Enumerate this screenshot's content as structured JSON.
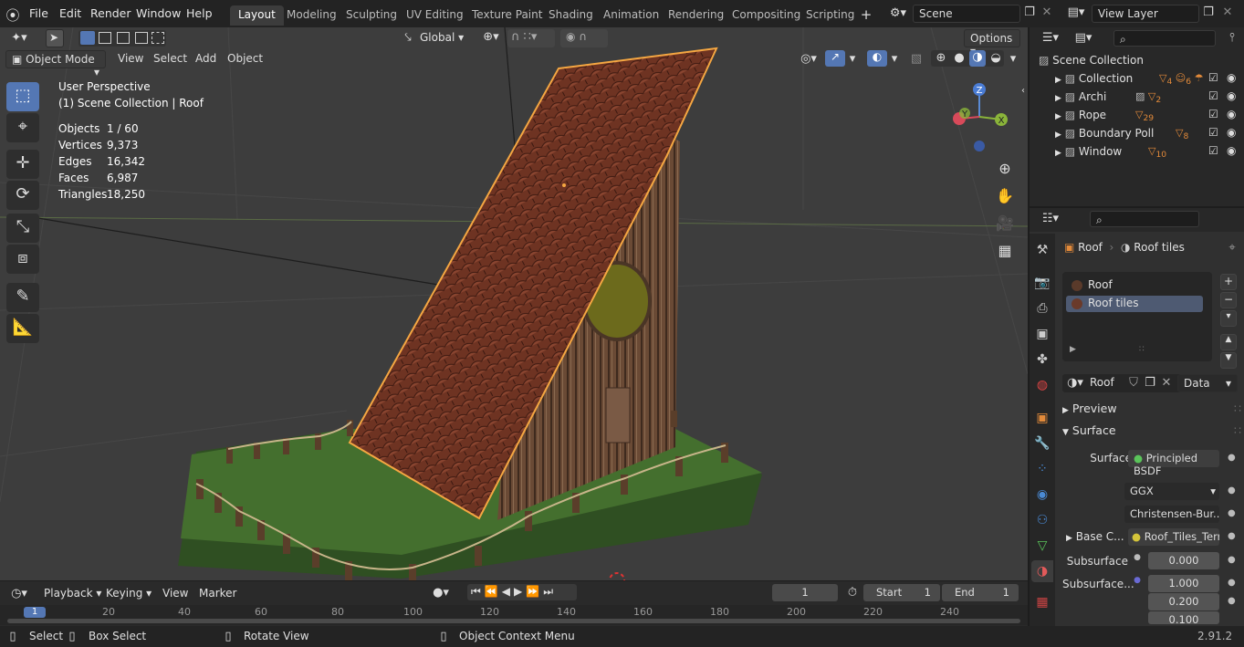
{
  "menubar": {
    "items": [
      "File",
      "Edit",
      "Render",
      "Window",
      "Help"
    ]
  },
  "workspaces": [
    "Layout",
    "Modeling",
    "Sculpting",
    "UV Editing",
    "Texture Paint",
    "Shading",
    "Animation",
    "Rendering",
    "Compositing",
    "Scripting"
  ],
  "active_workspace": "Layout",
  "scene": {
    "name": "Scene"
  },
  "view_layer": {
    "name": "View Layer"
  },
  "viewport_header": {
    "transform_orientation": "Global",
    "options_label": "Options",
    "mode": "Object Mode",
    "menus": [
      "View",
      "Select",
      "Add",
      "Object"
    ]
  },
  "overlay_info": {
    "perspective": "User Perspective",
    "context": "(1) Scene Collection | Roof",
    "stats": [
      {
        "label": "Objects",
        "value": "1 / 60"
      },
      {
        "label": "Vertices",
        "value": "9,373"
      },
      {
        "label": "Edges",
        "value": "16,342"
      },
      {
        "label": "Faces",
        "value": "6,987"
      },
      {
        "label": "Triangles",
        "value": "18,250"
      }
    ]
  },
  "gizmo": {
    "x": "X",
    "y": "Y",
    "z": "Z"
  },
  "outliner": {
    "root": "Scene Collection",
    "collections": [
      {
        "name": "Collection",
        "badges": [
          "4",
          "6"
        ]
      },
      {
        "name": "Archi",
        "badges": [
          "2"
        ]
      },
      {
        "name": "Rope",
        "badges": [
          "29"
        ]
      },
      {
        "name": "Boundary Poll",
        "badges": [
          "8"
        ]
      },
      {
        "name": "Window",
        "badges": [
          "10"
        ]
      }
    ]
  },
  "properties": {
    "breadcrumb_object": "Roof",
    "breadcrumb_material": "Roof tiles",
    "material_slots": [
      "Roof",
      "Roof tiles"
    ],
    "selected_slot": "Roof tiles",
    "material_name": "Roof",
    "link_mode": "Data",
    "panels": {
      "preview": "Preview",
      "surface": "Surface"
    },
    "surface_label": "Surface",
    "surface_shader": "Principled BSDF",
    "distribution": "GGX",
    "subsurface_method": "Christensen-Bur...",
    "base_color_label": "Base C...",
    "base_color_value": "Roof_Tiles_Terr...",
    "subsurface_label": "Subsurface",
    "subsurface_value": "0.000",
    "subsurface_radius_label": "Subsurface...",
    "subsurface_radius": [
      "1.000",
      "0.200",
      "0.100"
    ]
  },
  "timeline": {
    "menus": [
      "Playback",
      "Keying",
      "View",
      "Marker"
    ],
    "current_frame": "1",
    "start_label": "Start",
    "start": "1",
    "end_label": "End",
    "end": "1",
    "ticks": [
      "1",
      "20",
      "40",
      "60",
      "80",
      "100",
      "120",
      "140",
      "160",
      "180",
      "200",
      "220",
      "240"
    ]
  },
  "statusbar": {
    "select": "Select",
    "box_select": "Box Select",
    "rotate_view": "Rotate View",
    "context_menu": "Object Context Menu",
    "version": "2.91.2"
  },
  "colors": {
    "accent_blue": "#5477b4",
    "selection_orange": "#f5a742",
    "roof_tile": "#7a3a26",
    "grass": "#3f6a2c"
  }
}
